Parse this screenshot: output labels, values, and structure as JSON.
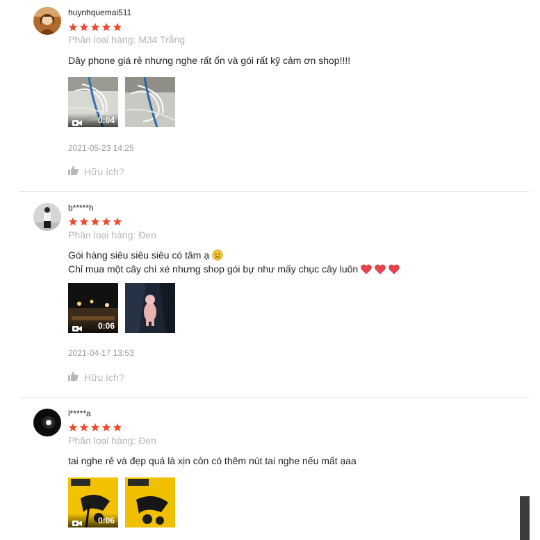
{
  "reviews": [
    {
      "username": "huynhquemai511",
      "rating": 5,
      "variant": "Phân loại hàng: M34 Trắng",
      "comment_lines": [
        "Dây phone giá rẻ nhưng nghe rất ổn và gói rất kỹ cảm ơn shop!!!!"
      ],
      "media": [
        {
          "type": "video",
          "duration": "0:04"
        },
        {
          "type": "image"
        }
      ],
      "datetime": "2021-05-23 14:25",
      "helpful_label": "Hữu ích?"
    },
    {
      "username": "b*****h",
      "rating": 5,
      "variant": "Phân loại hàng: Đen",
      "comment_lines": [
        "Gói hàng siêu siêu siêu có tâm ạ",
        "Chỉ mua một cây chì xé nhưng shop gói bự như mấy chục cây luôn"
      ],
      "media": [
        {
          "type": "video",
          "duration": "0:06"
        },
        {
          "type": "image"
        }
      ],
      "datetime": "2021-04-17 13:53",
      "helpful_label": "Hữu ích?"
    },
    {
      "username": "l*****a",
      "rating": 5,
      "variant": "Phân loại hàng: Đen",
      "comment_lines": [
        "tai nghe rẻ và đẹp quá là xịn còn có thêm nút tai nghe nếu mất ạaa"
      ],
      "media": [
        {
          "type": "video",
          "duration": "0:06"
        },
        {
          "type": "image"
        }
      ],
      "datetime": "",
      "helpful_label": ""
    }
  ],
  "colors": {
    "star": "#ee4d2d",
    "variant_text": "#b5b5b5",
    "divider": "#e5e5e5",
    "heart": "#e8434e"
  },
  "icons": {
    "video": "video-camera-icon",
    "helpful": "thumbs-up-icon",
    "emoji": "worried-face-icon",
    "heart": "heart-icon"
  }
}
